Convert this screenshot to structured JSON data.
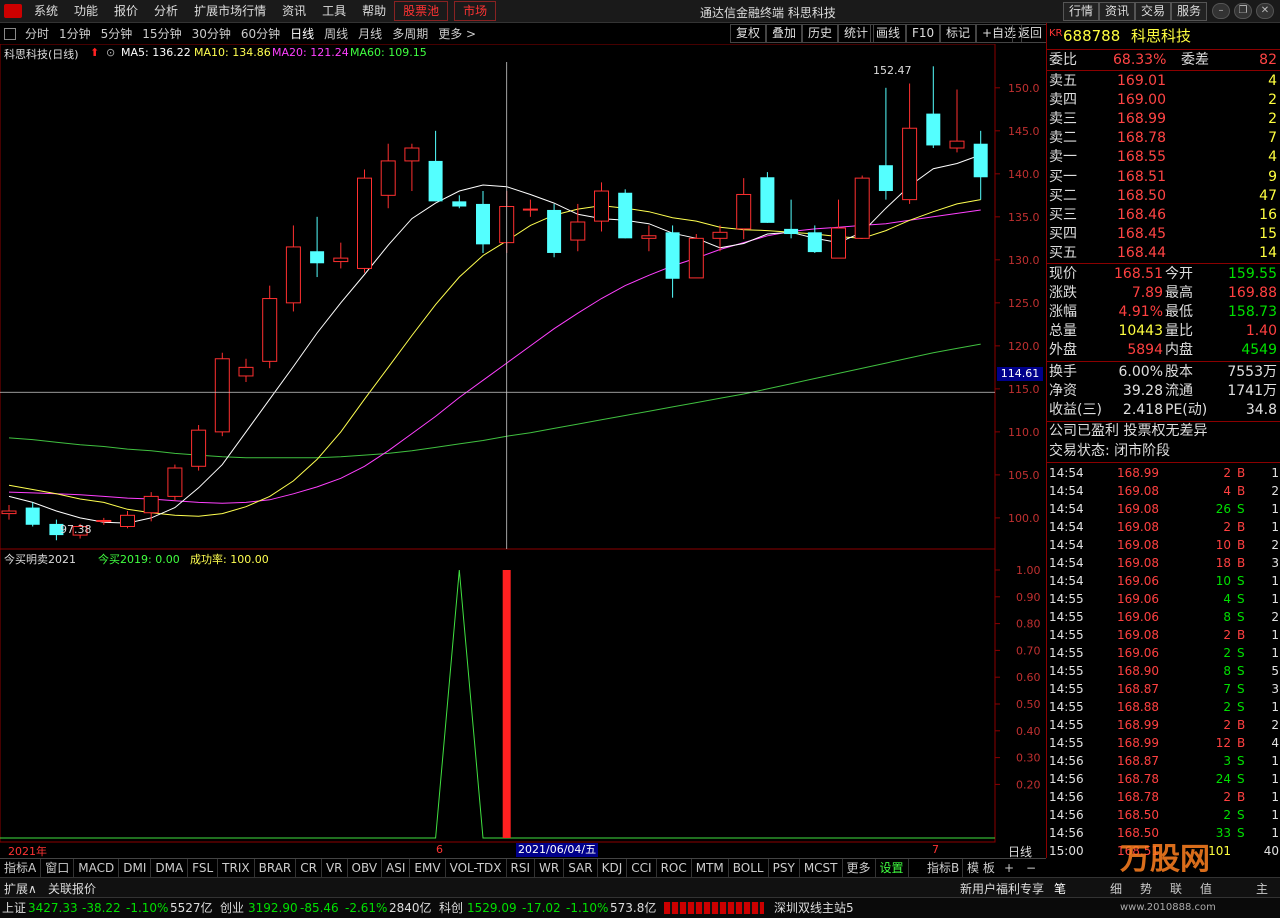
{
  "menu": {
    "items": [
      "系统",
      "功能",
      "报价",
      "分析",
      "扩展市场行情",
      "资讯",
      "工具",
      "帮助"
    ],
    "highlight": [
      "股票池",
      "市场"
    ],
    "title": "通达信金融终端  科思科技",
    "right_buttons": [
      "行情",
      "资讯",
      "交易",
      "服务"
    ]
  },
  "periods": [
    "分时",
    "1分钟",
    "5分钟",
    "15分钟",
    "30分钟",
    "60分钟",
    "日线",
    "周线",
    "月线",
    "多周期",
    "更多 >"
  ],
  "active_period": "日线",
  "tools": [
    "复权",
    "叠加",
    "历史",
    "统计",
    "画线",
    "F10",
    "标记",
    "+自选",
    "返回"
  ],
  "main_chart": {
    "name": "科思科技(日线)",
    "ma5": "MA5: 136.22",
    "ma10": "MA10: 134.86",
    "ma20": "MA20: 121.24",
    "ma60": "MA60: 109.15",
    "high_label": "152.47",
    "low_label": "97.38",
    "crosshair_price": "114.61",
    "crosshair_date": "2021/06/04/五",
    "year_label": "2021年",
    "month_labels": [
      "6",
      "7"
    ],
    "bottom_right": "日线"
  },
  "chart_data": [
    {
      "type": "candlestick",
      "title": "科思科技(日线)",
      "yticks": [
        100.0,
        105.0,
        110.0,
        115.0,
        120.0,
        125.0,
        130.0,
        135.0,
        140.0,
        145.0,
        150.0
      ],
      "ylim": [
        96.5,
        153.0
      ],
      "candles": [
        {
          "o": 100.5,
          "h": 101.5,
          "l": 99.8,
          "c": 100.8
        },
        {
          "o": 101.2,
          "h": 101.8,
          "l": 99.0,
          "c": 99.2
        },
        {
          "o": 99.3,
          "h": 99.8,
          "l": 97.4,
          "c": 98.0
        },
        {
          "o": 98.0,
          "h": 99.3,
          "l": 97.6,
          "c": 99.0
        },
        {
          "o": 99.6,
          "h": 100.0,
          "l": 99.2,
          "c": 99.7
        },
        {
          "o": 99.0,
          "h": 100.8,
          "l": 98.8,
          "c": 100.3
        },
        {
          "o": 100.6,
          "h": 103.0,
          "l": 99.6,
          "c": 102.5
        },
        {
          "o": 102.5,
          "h": 106.2,
          "l": 102.0,
          "c": 105.8
        },
        {
          "o": 106.0,
          "h": 110.8,
          "l": 105.5,
          "c": 110.2
        },
        {
          "o": 110.0,
          "h": 119.2,
          "l": 109.5,
          "c": 118.5
        },
        {
          "o": 116.5,
          "h": 118.5,
          "l": 115.8,
          "c": 117.5
        },
        {
          "o": 118.2,
          "h": 127.0,
          "l": 117.4,
          "c": 125.5
        },
        {
          "o": 125.0,
          "h": 134.0,
          "l": 124.0,
          "c": 131.5
        },
        {
          "o": 131.0,
          "h": 135.0,
          "l": 128.0,
          "c": 129.6
        },
        {
          "o": 129.8,
          "h": 132.0,
          "l": 129.0,
          "c": 130.2
        },
        {
          "o": 129.0,
          "h": 140.5,
          "l": 128.5,
          "c": 139.5
        },
        {
          "o": 137.5,
          "h": 143.5,
          "l": 136.0,
          "c": 141.5
        },
        {
          "o": 141.5,
          "h": 143.5,
          "l": 138.0,
          "c": 143.0
        },
        {
          "o": 141.5,
          "h": 145.0,
          "l": 136.8,
          "c": 136.8
        },
        {
          "o": 136.8,
          "h": 137.5,
          "l": 136.0,
          "c": 136.2
        },
        {
          "o": 136.5,
          "h": 138.0,
          "l": 130.8,
          "c": 131.8
        },
        {
          "o": 132.0,
          "h": 138.0,
          "l": 130.8,
          "c": 136.2
        },
        {
          "o": 135.8,
          "h": 137.0,
          "l": 135.0,
          "c": 135.9
        },
        {
          "o": 135.8,
          "h": 136.5,
          "l": 130.3,
          "c": 130.8
        },
        {
          "o": 132.3,
          "h": 136.5,
          "l": 131.0,
          "c": 134.4
        },
        {
          "o": 134.5,
          "h": 139.0,
          "l": 133.3,
          "c": 138.0
        },
        {
          "o": 137.8,
          "h": 138.2,
          "l": 132.5,
          "c": 132.5
        },
        {
          "o": 132.5,
          "h": 134.0,
          "l": 131.0,
          "c": 132.8
        },
        {
          "o": 133.2,
          "h": 134.0,
          "l": 125.6,
          "c": 127.8
        },
        {
          "o": 127.9,
          "h": 133.0,
          "l": 127.9,
          "c": 132.5
        },
        {
          "o": 132.5,
          "h": 134.0,
          "l": 131.0,
          "c": 133.2
        },
        {
          "o": 133.6,
          "h": 139.5,
          "l": 132.4,
          "c": 137.6
        },
        {
          "o": 139.6,
          "h": 140.2,
          "l": 134.3,
          "c": 134.3
        },
        {
          "o": 133.6,
          "h": 137.0,
          "l": 132.5,
          "c": 133.0
        },
        {
          "o": 133.2,
          "h": 134.0,
          "l": 130.8,
          "c": 130.9
        },
        {
          "o": 130.2,
          "h": 137.0,
          "l": 130.2,
          "c": 133.7
        },
        {
          "o": 132.5,
          "h": 139.8,
          "l": 132.5,
          "c": 139.5
        },
        {
          "o": 141.0,
          "h": 150.0,
          "l": 137.0,
          "c": 138.0
        },
        {
          "o": 137.0,
          "h": 150.5,
          "l": 136.5,
          "c": 145.3
        },
        {
          "o": 147.0,
          "h": 152.5,
          "l": 143.0,
          "c": 143.3
        },
        {
          "o": 143.0,
          "h": 149.8,
          "l": 142.5,
          "c": 143.8
        },
        {
          "o": 143.5,
          "h": 145.0,
          "l": 137.0,
          "c": 139.6
        }
      ],
      "ma5": [
        102.5,
        101.8,
        100.8,
        100.0,
        99.5,
        99.4,
        100.0,
        101.2,
        103.5,
        106.2,
        110.0,
        113.8,
        117.6,
        121.5,
        125.0,
        128.3,
        131.7,
        134.8,
        136.6,
        138.0,
        138.7,
        138.5,
        137.6,
        136.6,
        135.3,
        134.8,
        134.6,
        134.2,
        133.1,
        132.5,
        131.4,
        131.9,
        133.0,
        133.2,
        132.5,
        132.0,
        133.2,
        136.0,
        138.6,
        140.6,
        141.2,
        142.2
      ],
      "ma10": [
        103.8,
        103.3,
        102.8,
        102.2,
        101.8,
        101.0,
        100.6,
        100.3,
        100.2,
        100.5,
        101.3,
        102.5,
        104.3,
        106.8,
        110.0,
        113.8,
        117.5,
        121.2,
        124.8,
        128.0,
        130.5,
        132.2,
        134.0,
        135.2,
        135.9,
        136.3,
        136.0,
        135.6,
        134.9,
        134.5,
        133.8,
        133.5,
        133.4,
        133.2,
        133.0,
        132.7,
        132.5,
        133.4,
        134.6,
        135.6,
        136.5,
        137.0
      ],
      "ma20": [
        103.0,
        102.9,
        102.8,
        102.7,
        102.5,
        102.3,
        102.2,
        102.0,
        101.8,
        101.7,
        101.8,
        102.1,
        102.8,
        103.6,
        104.6,
        106.0,
        107.8,
        109.8,
        111.8,
        114.0,
        116.0,
        118.0,
        120.0,
        122.0,
        123.8,
        125.5,
        127.0,
        128.2,
        129.3,
        130.2,
        131.2,
        132.0,
        132.8,
        133.3,
        133.6,
        133.8,
        134.0,
        134.2,
        134.6,
        135.0,
        135.4,
        135.8
      ],
      "ma60": [
        109.3,
        109.1,
        108.8,
        108.5,
        108.3,
        108.0,
        107.8,
        107.5,
        107.3,
        107.1,
        107.0,
        107.0,
        107.0,
        107.0,
        107.1,
        107.3,
        107.5,
        107.8,
        108.2,
        108.6,
        109.0,
        109.5,
        109.9,
        110.4,
        110.9,
        111.4,
        111.9,
        112.4,
        112.9,
        113.4,
        113.9,
        114.4,
        115.0,
        115.6,
        116.2,
        116.8,
        117.4,
        118.0,
        118.6,
        119.2,
        119.7,
        120.2
      ]
    },
    {
      "type": "line",
      "title": "今买明卖2021",
      "series": [
        {
          "name": "今买2019",
          "values": [
            0,
            0,
            0,
            0,
            0,
            0,
            0,
            0,
            0,
            0,
            0,
            0,
            0,
            0,
            0,
            0,
            0,
            0,
            0,
            1,
            0,
            0,
            0,
            0,
            0,
            0,
            0,
            0,
            0,
            0,
            0,
            0,
            0,
            0,
            0,
            0,
            0,
            0,
            0,
            0,
            0,
            0
          ]
        }
      ],
      "bar_index": 21,
      "bar_value": 1.0,
      "yticks": [
        0.2,
        0.3,
        0.4,
        0.5,
        0.6,
        0.7,
        0.8,
        0.9,
        1.0
      ],
      "ylim": [
        0,
        1.0
      ]
    }
  ],
  "indicator": {
    "name": "今买明卖2021",
    "buy": "今买2019: 0.00",
    "rate": "成功率: 100.00"
  },
  "panel": {
    "code": "688788",
    "name": "科思科技",
    "kr": "KR",
    "weibi_label": "委比",
    "weibi": "68.33%",
    "weicha_label": "委差",
    "weicha": "82",
    "sell": [
      {
        "l": "卖五",
        "p": "169.01",
        "v": "4"
      },
      {
        "l": "卖四",
        "p": "169.00",
        "v": "2"
      },
      {
        "l": "卖三",
        "p": "168.99",
        "v": "2"
      },
      {
        "l": "卖二",
        "p": "168.78",
        "v": "7"
      },
      {
        "l": "卖一",
        "p": "168.55",
        "v": "4"
      }
    ],
    "buy": [
      {
        "l": "买一",
        "p": "168.51",
        "v": "9"
      },
      {
        "l": "买二",
        "p": "168.50",
        "v": "47"
      },
      {
        "l": "买三",
        "p": "168.46",
        "v": "16"
      },
      {
        "l": "买四",
        "p": "168.45",
        "v": "15"
      },
      {
        "l": "买五",
        "p": "168.44",
        "v": "14"
      }
    ],
    "stats": [
      {
        "l1": "现价",
        "v1": "168.51",
        "l2": "今开",
        "v2": "159.55",
        "c1": "up",
        "c2": "dn"
      },
      {
        "l1": "涨跌",
        "v1": "7.89",
        "l2": "最高",
        "v2": "169.88",
        "c1": "up",
        "c2": "up"
      },
      {
        "l1": "涨幅",
        "v1": "4.91%",
        "l2": "最低",
        "v2": "158.73",
        "c1": "up",
        "c2": "dn"
      },
      {
        "l1": "总量",
        "v1": "10443",
        "l2": "量比",
        "v2": "1.40",
        "c1": "yl",
        "c2": "up"
      },
      {
        "l1": "外盘",
        "v1": "5894",
        "l2": "内盘",
        "v2": "4549",
        "c1": "up",
        "c2": "dn"
      }
    ],
    "stats2": [
      {
        "l1": "换手",
        "v1": "6.00%",
        "l2": "股本",
        "v2": "7553万"
      },
      {
        "l1": "净资",
        "v1": "39.28",
        "l2": "流通",
        "v2": "1741万"
      },
      {
        "l1": "收益(三)",
        "v1": "2.418",
        "l2": "PE(动)",
        "v2": "34.8"
      }
    ],
    "notice1": "公司已盈利 投票权无差异",
    "notice2": "交易状态: 闭市阶段",
    "ticks": [
      {
        "t": "14:54",
        "p": "168.99",
        "v": "2",
        "d": "B",
        "n": "1"
      },
      {
        "t": "14:54",
        "p": "169.08",
        "v": "4",
        "d": "B",
        "n": "2"
      },
      {
        "t": "14:54",
        "p": "169.08",
        "v": "26",
        "d": "S",
        "n": "1"
      },
      {
        "t": "14:54",
        "p": "169.08",
        "v": "2",
        "d": "B",
        "n": "1"
      },
      {
        "t": "14:54",
        "p": "169.08",
        "v": "10",
        "d": "B",
        "n": "2"
      },
      {
        "t": "14:54",
        "p": "169.08",
        "v": "18",
        "d": "B",
        "n": "3"
      },
      {
        "t": "14:54",
        "p": "169.06",
        "v": "10",
        "d": "S",
        "n": "1"
      },
      {
        "t": "14:55",
        "p": "169.06",
        "v": "4",
        "d": "S",
        "n": "1"
      },
      {
        "t": "14:55",
        "p": "169.06",
        "v": "8",
        "d": "S",
        "n": "2"
      },
      {
        "t": "14:55",
        "p": "169.08",
        "v": "2",
        "d": "B",
        "n": "1"
      },
      {
        "t": "14:55",
        "p": "169.06",
        "v": "2",
        "d": "S",
        "n": "1"
      },
      {
        "t": "14:55",
        "p": "168.90",
        "v": "8",
        "d": "S",
        "n": "5"
      },
      {
        "t": "14:55",
        "p": "168.87",
        "v": "7",
        "d": "S",
        "n": "3"
      },
      {
        "t": "14:55",
        "p": "168.88",
        "v": "2",
        "d": "S",
        "n": "1"
      },
      {
        "t": "14:55",
        "p": "168.99",
        "v": "2",
        "d": "B",
        "n": "2"
      },
      {
        "t": "14:55",
        "p": "168.99",
        "v": "12",
        "d": "B",
        "n": "4"
      },
      {
        "t": "14:56",
        "p": "168.87",
        "v": "3",
        "d": "S",
        "n": "1"
      },
      {
        "t": "14:56",
        "p": "168.78",
        "v": "24",
        "d": "S",
        "n": "1"
      },
      {
        "t": "14:56",
        "p": "168.78",
        "v": "2",
        "d": "B",
        "n": "1"
      },
      {
        "t": "14:56",
        "p": "168.50",
        "v": "2",
        "d": "S",
        "n": "1"
      },
      {
        "t": "14:56",
        "p": "168.50",
        "v": "33",
        "d": "S",
        "n": "1"
      },
      {
        "t": "15:00",
        "p": "168.51",
        "v": "101",
        "d": "",
        "n": "40"
      }
    ]
  },
  "indicators": [
    "指标A",
    "窗口",
    "MACD",
    "DMI",
    "DMA",
    "FSL",
    "TRIX",
    "BRAR",
    "CR",
    "VR",
    "OBV",
    "ASI",
    "EMV",
    "VOL-TDX",
    "RSI",
    "WR",
    "SAR",
    "KDJ",
    "CCI",
    "ROC",
    "MTM",
    "BOLL",
    "PSY",
    "MCST",
    "更多",
    "设置"
  ],
  "indicator_right": [
    "指标B",
    "模 板",
    "+",
    "−"
  ],
  "extbar": {
    "left1": "扩展∧",
    "left2": "关联报价",
    "right": "新用户福利专享",
    "tabs": [
      "笔",
      "细",
      "势",
      "联",
      "值",
      "主"
    ]
  },
  "status": {
    "sh_label": "上证",
    "sh": "3427.33",
    "sh_chg": "-38.22",
    "sh_pct": "-1.10%",
    "sh_amt": "5527亿",
    "cy_label": "创业",
    "cy": "3192.90",
    "cy_chg": "-85.46",
    "cy_pct": "-2.61%",
    "cy_amt": "2840亿",
    "kc_label": "科创",
    "kc": "1529.09",
    "kc_chg": "-17.02",
    "kc_pct": "-1.10%",
    "kc_amt": "573.8亿",
    "server": "深圳双线主站5",
    "watermark": "万股网",
    "site": "www.2010888.com"
  }
}
